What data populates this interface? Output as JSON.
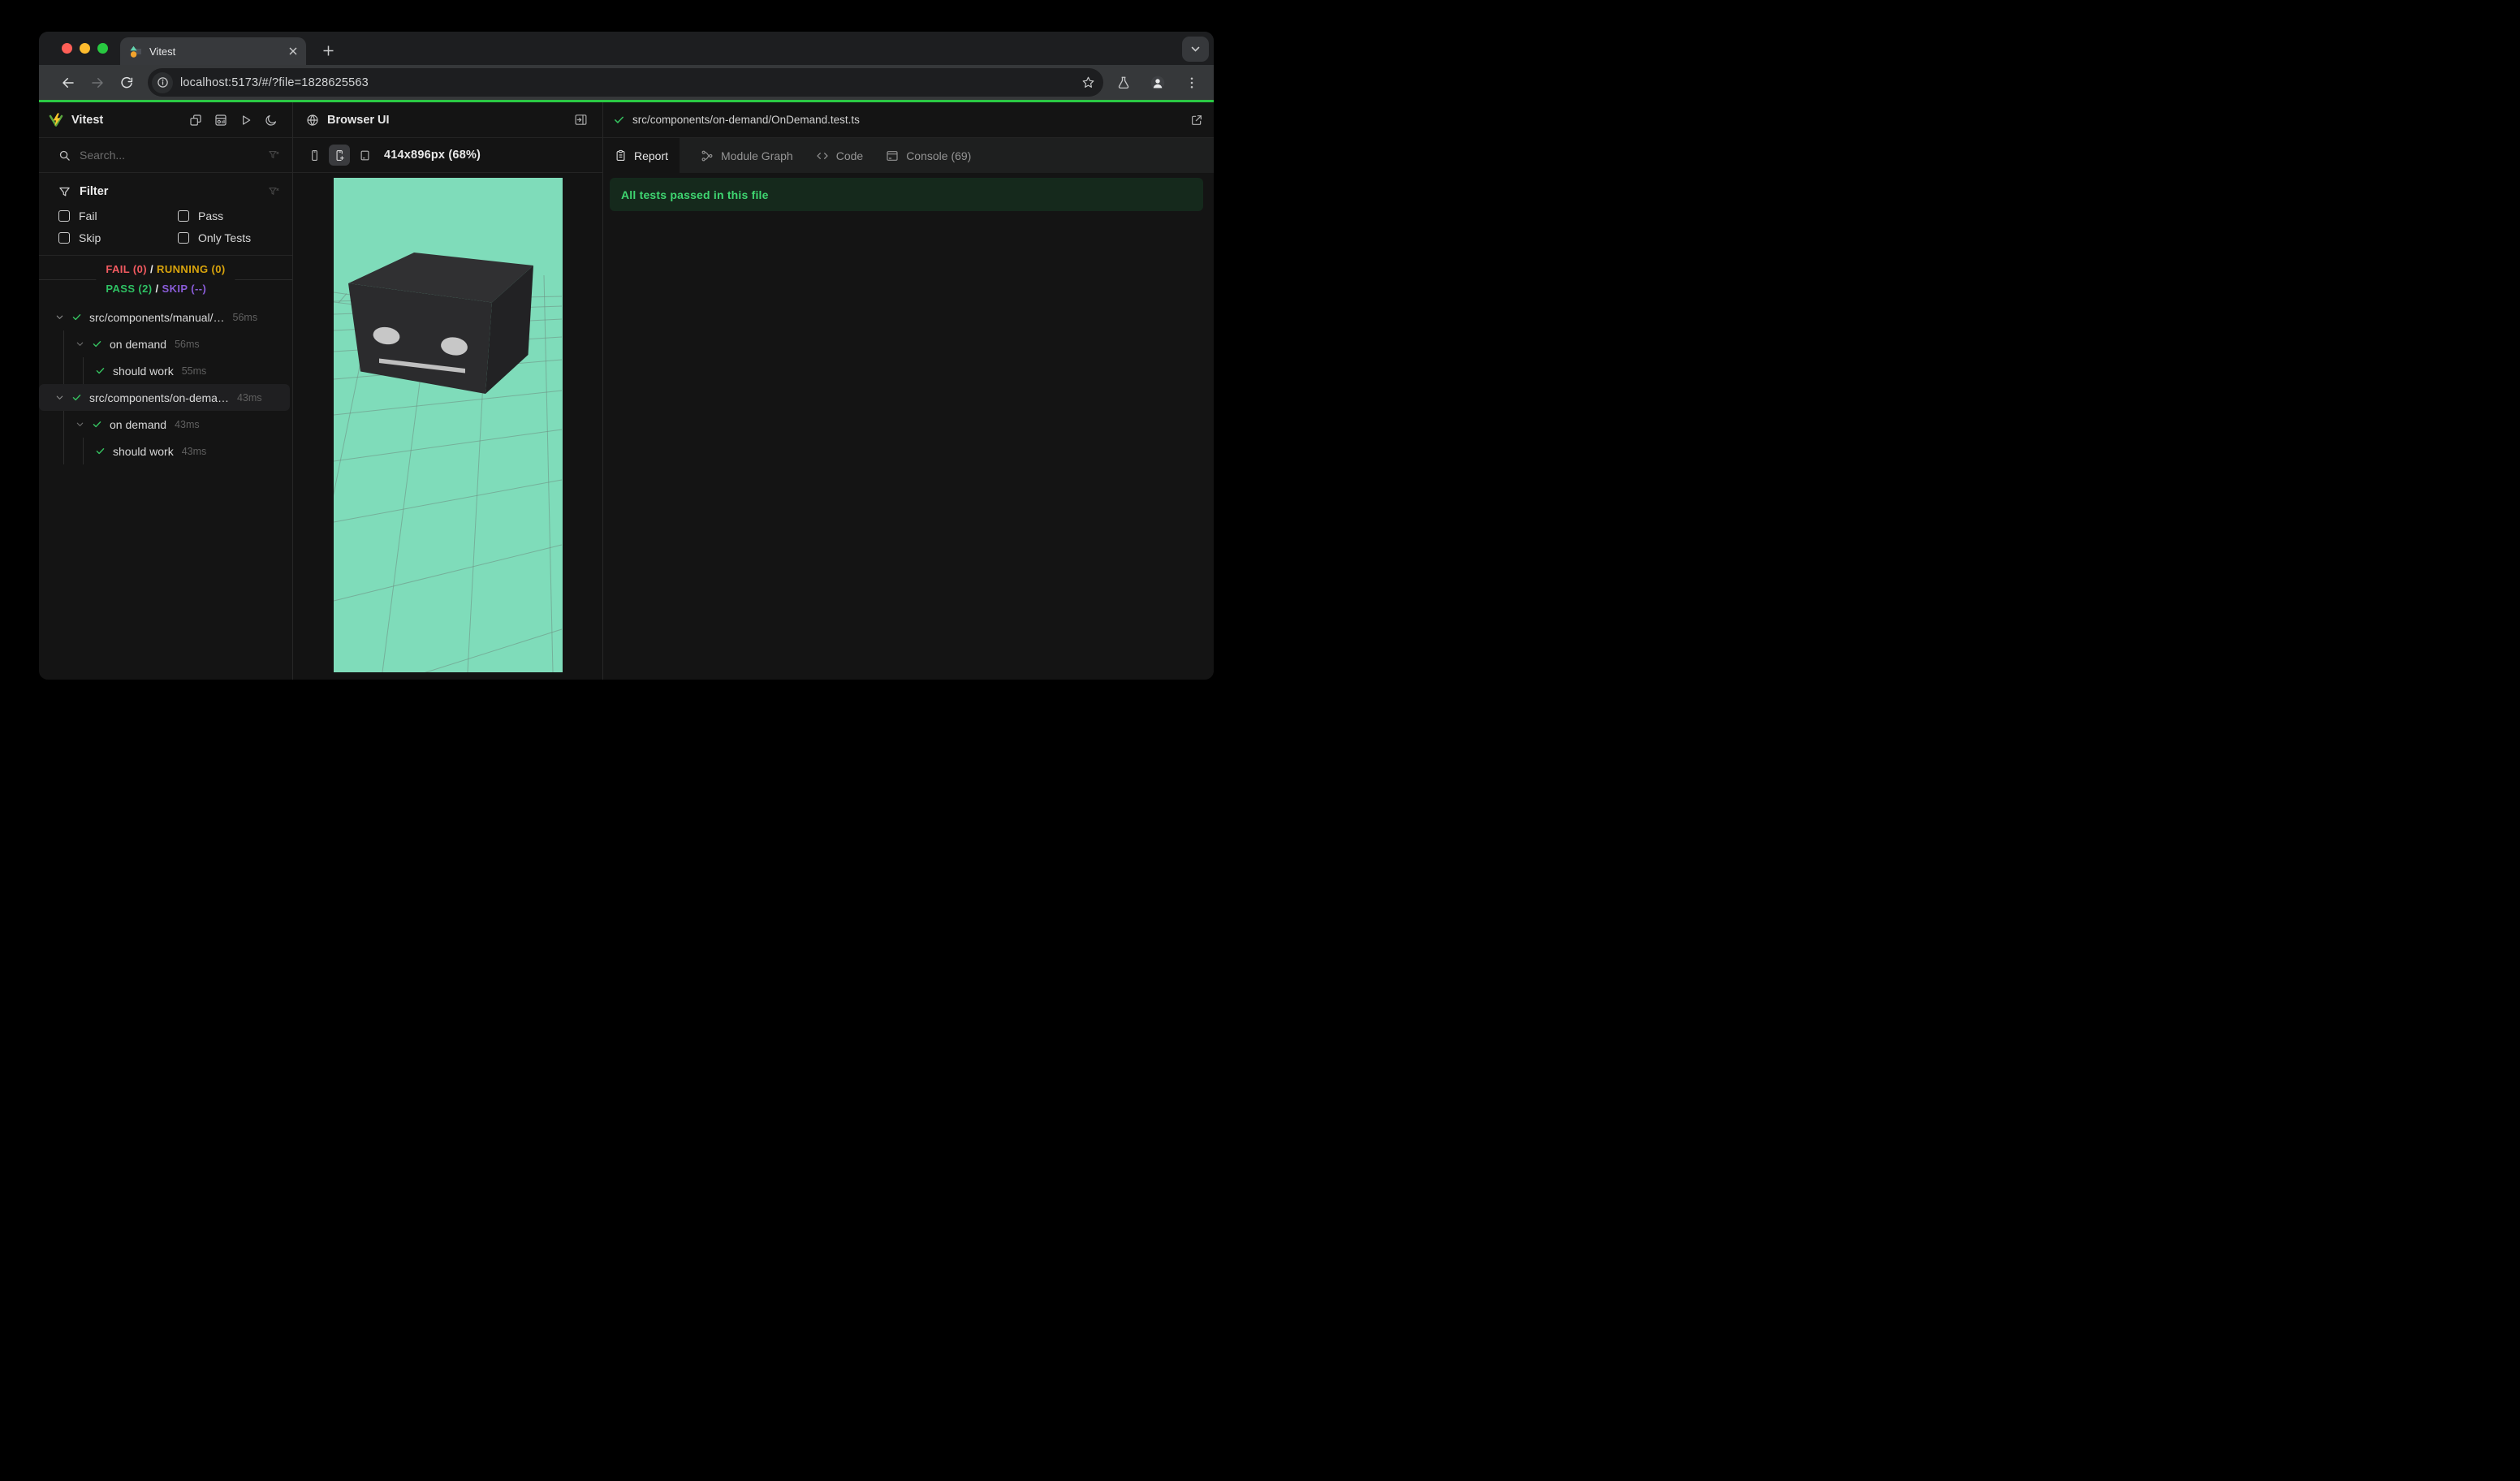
{
  "browser": {
    "tab": {
      "title": "Vitest"
    },
    "url": "localhost:5173/#/?file=1828625563"
  },
  "sidebar": {
    "title": "Vitest",
    "search_placeholder": "Search...",
    "filter": {
      "title": "Filter",
      "options": [
        "Fail",
        "Pass",
        "Skip",
        "Only Tests"
      ]
    },
    "summary": {
      "fail": "FAIL (0)",
      "running": "RUNNING (0)",
      "pass": "PASS (2)",
      "skip": "SKIP (--)",
      "separator": "/"
    },
    "tree": [
      {
        "label": "src/components/manual/…",
        "duration": "56ms"
      },
      {
        "label": "on demand",
        "duration": "56ms"
      },
      {
        "label": "should work",
        "duration": "55ms"
      },
      {
        "label": "src/components/on-dema…",
        "duration": "43ms"
      },
      {
        "label": "on demand",
        "duration": "43ms"
      },
      {
        "label": "should work",
        "duration": "43ms"
      }
    ]
  },
  "browser_panel": {
    "title": "Browser UI",
    "viewport_size_label": "414x896px (68%)"
  },
  "report_panel": {
    "file_path": "src/components/on-demand/OnDemand.test.ts",
    "tabs": [
      {
        "label": "Report"
      },
      {
        "label": "Module Graph"
      },
      {
        "label": "Code"
      },
      {
        "label": "Console (69)"
      }
    ],
    "banner": "All tests passed in this file"
  },
  "colors": {
    "progress_green": "#2bc944",
    "pass_green": "#35c05f",
    "fail_red": "#f25a60",
    "running_yellow": "#d9a40c",
    "skip_purple": "#8a5cd8",
    "viewport_mint": "#7fdcba",
    "banner_bg": "#15291c",
    "banner_text": "#3fd671"
  }
}
